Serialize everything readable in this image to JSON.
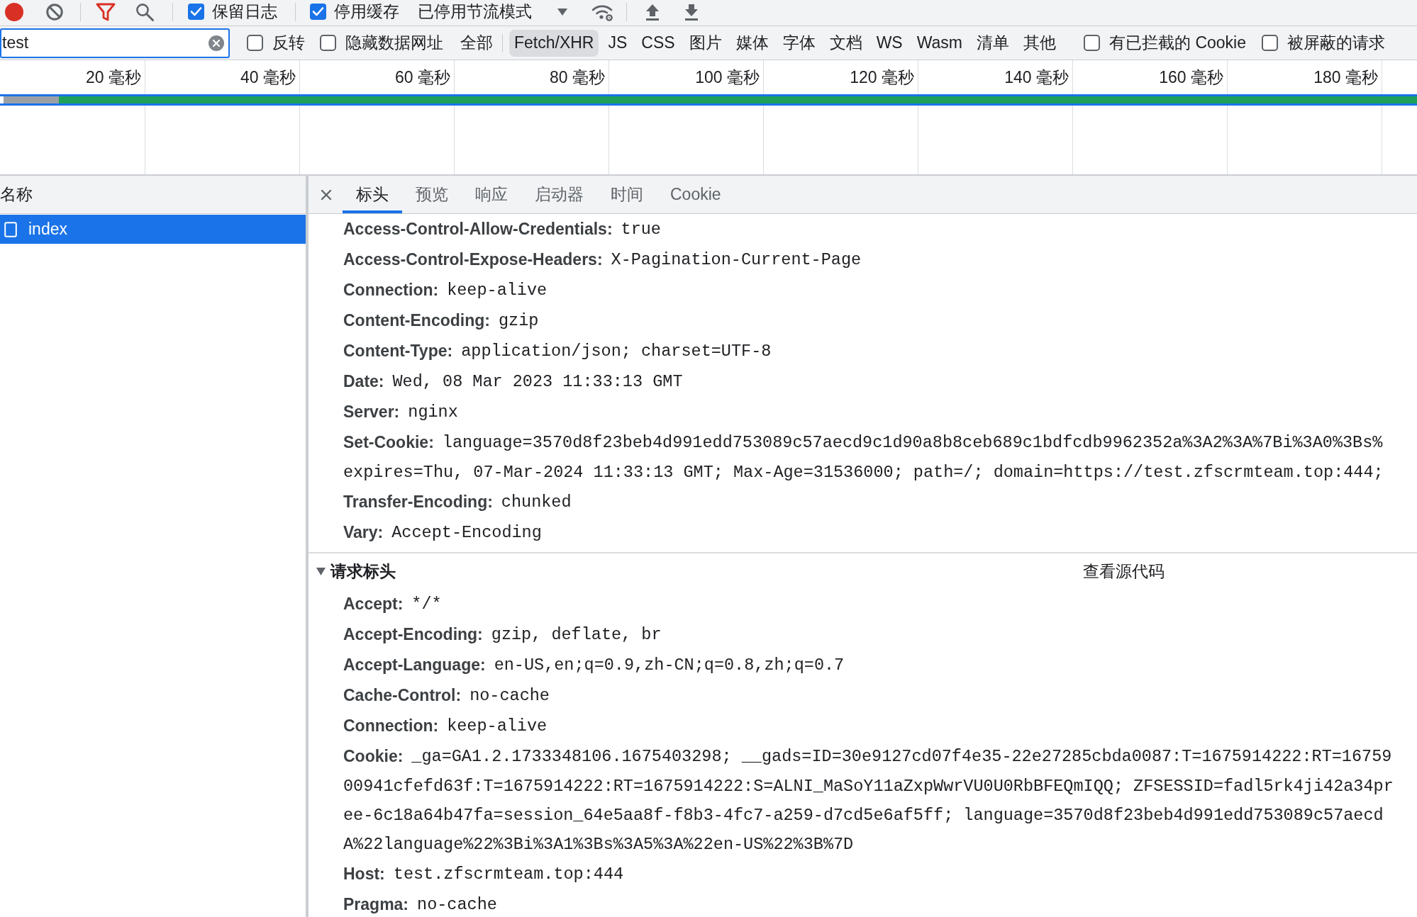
{
  "toolbar": {
    "recording": true,
    "filter_active": true,
    "checkboxes": [
      {
        "label": "保留日志",
        "checked": true
      },
      {
        "label": "停用缓存",
        "checked": true
      }
    ],
    "throttling": "已停用节流模式"
  },
  "filter_bar": {
    "search": {
      "value": "test"
    },
    "options": [
      {
        "label": "反转",
        "checked": false
      },
      {
        "label": "隐藏数据网址",
        "checked": false
      }
    ],
    "types": [
      {
        "label": "全部",
        "selected": false
      },
      {
        "label": "Fetch/XHR",
        "selected": true
      },
      {
        "label": "JS",
        "selected": false
      },
      {
        "label": "CSS",
        "selected": false
      },
      {
        "label": "图片",
        "selected": false
      },
      {
        "label": "媒体",
        "selected": false
      },
      {
        "label": "字体",
        "selected": false
      },
      {
        "label": "文档",
        "selected": false
      },
      {
        "label": "WS",
        "selected": false
      },
      {
        "label": "Wasm",
        "selected": false
      },
      {
        "label": "清单",
        "selected": false
      },
      {
        "label": "其他",
        "selected": false
      }
    ],
    "extra_options": [
      {
        "label": "有已拦截的 Cookie",
        "checked": false
      },
      {
        "label": "被屏蔽的请求",
        "checked": false
      }
    ]
  },
  "timeline": {
    "ticks": [
      "20 毫秒",
      "40 毫秒",
      "60 毫秒",
      "80 毫秒",
      "100 毫秒",
      "120 毫秒",
      "140 毫秒",
      "160 毫秒",
      "180 毫秒"
    ]
  },
  "requests": {
    "column": "名称",
    "rows": [
      {
        "name": "index",
        "selected": true
      }
    ]
  },
  "details": {
    "tabs": [
      {
        "label": "标头",
        "selected": true
      },
      {
        "label": "预览",
        "selected": false
      },
      {
        "label": "响应",
        "selected": false
      },
      {
        "label": "启动器",
        "selected": false
      },
      {
        "label": "时间",
        "selected": false
      },
      {
        "label": "Cookie",
        "selected": false
      }
    ],
    "response_headers": [
      {
        "name": "Access-Control-Allow-Credentials:",
        "value_lines": [
          "true"
        ]
      },
      {
        "name": "Access-Control-Expose-Headers:",
        "value_lines": [
          "X-Pagination-Current-Page"
        ]
      },
      {
        "name": "Connection:",
        "value_lines": [
          "keep-alive"
        ]
      },
      {
        "name": "Content-Encoding:",
        "value_lines": [
          "gzip"
        ]
      },
      {
        "name": "Content-Type:",
        "value_lines": [
          "application/json; charset=UTF-8"
        ]
      },
      {
        "name": "Date:",
        "value_lines": [
          "Wed, 08 Mar 2023 11:33:13 GMT"
        ]
      },
      {
        "name": "Server:",
        "value_lines": [
          "nginx"
        ]
      },
      {
        "name": "Set-Cookie:",
        "value_lines": [
          "language=3570d8f23beb4d991edd753089c57aecd9c1d90a8b8ceb689c1bdfcdb9962352a%3A2%3A%7Bi%3A0%3Bs%",
          "expires=Thu, 07-Mar-2024 11:33:13 GMT; Max-Age=31536000; path=/; domain=https://test.zfscrmteam.top:444;"
        ]
      },
      {
        "name": "Transfer-Encoding:",
        "value_lines": [
          "chunked"
        ]
      },
      {
        "name": "Vary:",
        "value_lines": [
          "Accept-Encoding"
        ]
      }
    ],
    "request_headers": {
      "title": "请求标头",
      "expanded": true,
      "view_source": "查看源代码",
      "headers": [
        {
          "name": "Accept:",
          "value_lines": [
            "*/*"
          ]
        },
        {
          "name": "Accept-Encoding:",
          "value_lines": [
            "gzip, deflate, br"
          ]
        },
        {
          "name": "Accept-Language:",
          "value_lines": [
            "en-US,en;q=0.9,zh-CN;q=0.8,zh;q=0.7"
          ]
        },
        {
          "name": "Cache-Control:",
          "value_lines": [
            "no-cache"
          ]
        },
        {
          "name": "Connection:",
          "value_lines": [
            "keep-alive"
          ]
        },
        {
          "name": "Cookie:",
          "value_lines": [
            "_ga=GA1.2.1733348106.1675403298; __gads=ID=30e9127cd07f4e35-22e27285cbda0087:T=1675914222:RT=16759",
            "00941cfefd63f:T=1675914222:RT=1675914222:S=ALNI_MaSoY11aZxpWwrVU0U0RbBFEQmIQQ; ZFSESSID=fadl5rk4ji42a34pr",
            "ee-6c18a64b47fa=session_64e5aa8f-f8b3-4fc7-a259-d7cd5e6af5ff; language=3570d8f23beb4d991edd753089c57aecd",
            "A%22language%22%3Bi%3A1%3Bs%3A5%3A%22en-US%22%3B%7D"
          ]
        },
        {
          "name": "Host:",
          "value_lines": [
            "test.zfscrmteam.top:444"
          ]
        },
        {
          "name": "Pragma:",
          "value_lines": [
            "no-cache"
          ]
        }
      ]
    }
  }
}
